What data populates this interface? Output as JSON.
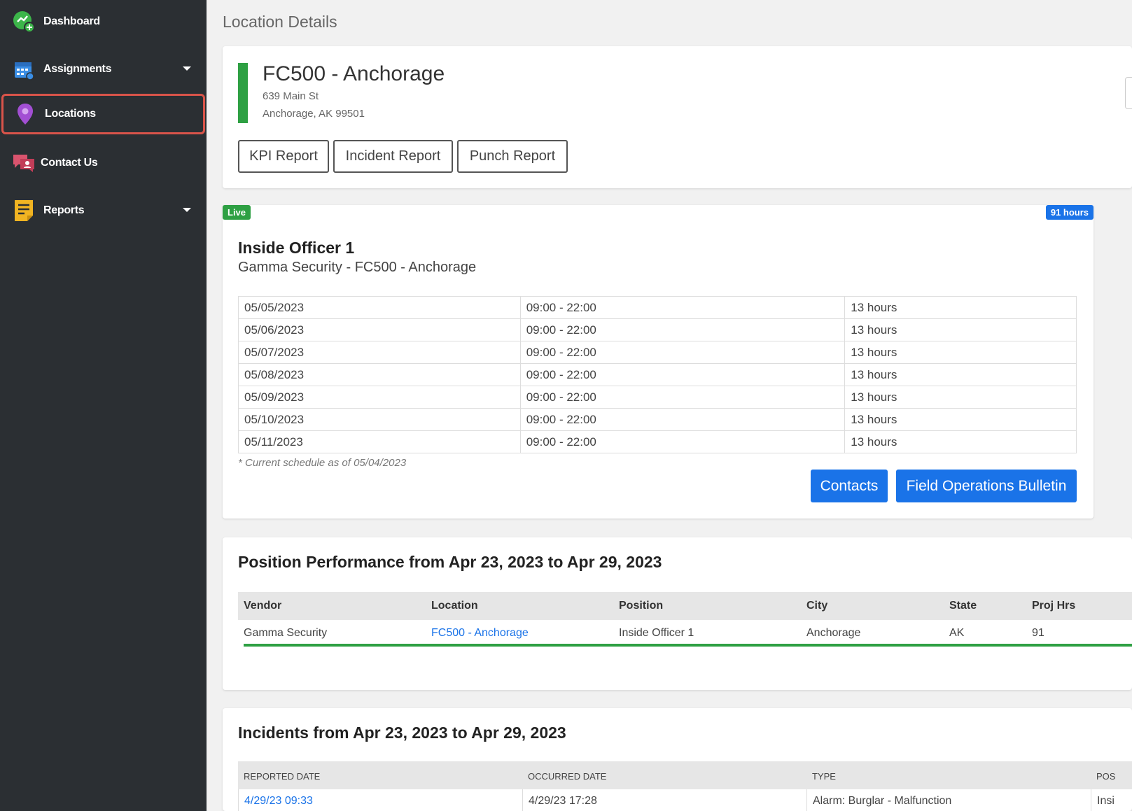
{
  "sidebar": {
    "items": [
      {
        "label": "Dashboard",
        "icon": "dashboard-icon",
        "color": "#3cb54a"
      },
      {
        "label": "Assignments",
        "icon": "calendar-icon",
        "color": "#3a8ee6"
      },
      {
        "label": "Locations",
        "icon": "map-pin-icon",
        "color": "#a24fd3"
      },
      {
        "label": "Contact Us",
        "icon": "chat-icon",
        "color": "#d9546e"
      },
      {
        "label": "Reports",
        "icon": "report-icon",
        "color": "#f1b422"
      }
    ],
    "active_index": 2
  },
  "page": {
    "title": "Location Details"
  },
  "location": {
    "name": "FC500 - Anchorage",
    "address_line1": "639 Main St",
    "address_line2": "Anchorage, AK 99501",
    "status_color": "#2ea043",
    "buttons": [
      "KPI Report",
      "Incident Report",
      "Punch Report"
    ]
  },
  "position": {
    "live_badge": "Live",
    "hours_badge": "91 hours",
    "title": "Inside Officer 1",
    "subtitle": "Gamma Security - FC500 - Anchorage",
    "schedule": [
      {
        "date": "05/05/2023",
        "time": "09:00 - 22:00",
        "hours": "13 hours"
      },
      {
        "date": "05/06/2023",
        "time": "09:00 - 22:00",
        "hours": "13 hours"
      },
      {
        "date": "05/07/2023",
        "time": "09:00 - 22:00",
        "hours": "13 hours"
      },
      {
        "date": "05/08/2023",
        "time": "09:00 - 22:00",
        "hours": "13 hours"
      },
      {
        "date": "05/09/2023",
        "time": "09:00 - 22:00",
        "hours": "13 hours"
      },
      {
        "date": "05/10/2023",
        "time": "09:00 - 22:00",
        "hours": "13 hours"
      },
      {
        "date": "05/11/2023",
        "time": "09:00 - 22:00",
        "hours": "13 hours"
      }
    ],
    "schedule_note": "* Current schedule as of 05/04/2023",
    "contacts_button": "Contacts",
    "bulletin_button": "Field Operations Bulletin"
  },
  "performance": {
    "title": "Position Performance from Apr 23, 2023 to Apr 29, 2023",
    "headers": [
      "Vendor",
      "Location",
      "Position",
      "City",
      "State",
      "Proj Hrs"
    ],
    "row": {
      "vendor": "Gamma Security",
      "location": "FC500 - Anchorage",
      "position": "Inside Officer 1",
      "city": "Anchorage",
      "state": "AK",
      "proj_hrs": "91"
    },
    "progress_fraction": 1.0
  },
  "incidents": {
    "title": "Incidents from Apr 23, 2023 to Apr 29, 2023",
    "headers": [
      "Reported Date",
      "Occurred Date",
      "Type",
      "Pos"
    ],
    "row": {
      "reported": "4/29/23 09:33",
      "occurred": "4/29/23 17:28",
      "type": "Alarm: Burglar - Malfunction",
      "position": "Insi"
    }
  }
}
